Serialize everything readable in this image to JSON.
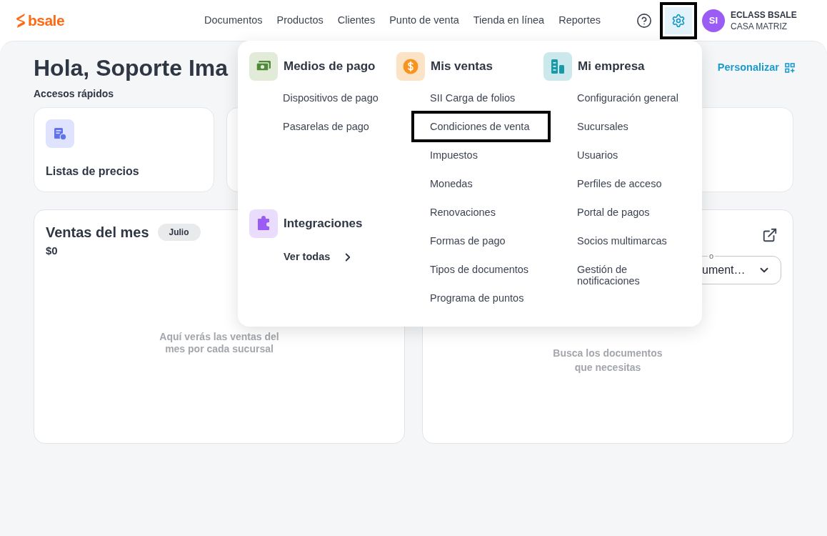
{
  "header": {
    "logo": "bsale",
    "nav": [
      {
        "label": "Documentos"
      },
      {
        "label": "Productos"
      },
      {
        "label": "Clientes"
      },
      {
        "label": "Punto de venta"
      },
      {
        "label": "Tienda en línea"
      },
      {
        "label": "Reportes"
      }
    ],
    "settings": {
      "highlighted": true
    },
    "user": {
      "initials": "SI",
      "name": "ECLASS BSALE",
      "branch": "CASA MATRIZ"
    }
  },
  "greeting": "Hola, Soporte Ima",
  "personalize": "Personalizar",
  "quick_access": {
    "title": "Accesos rápidos",
    "cards": [
      {
        "label": "Listas de precios"
      }
    ]
  },
  "sales_widget": {
    "title": "Ventas del mes",
    "badge": "Julio",
    "amount": "$0",
    "empty_text": "Aquí verás las ventas del mes por cada sucursal"
  },
  "documents_widget": {
    "select_label": "o",
    "select_value": "ument…",
    "empty_text": "Busca los documentos que necesitas"
  },
  "menu": {
    "sections": [
      {
        "title": "Medios de pago",
        "items": [
          {
            "label": "Dispositivos de pago",
            "highlighted": false
          },
          {
            "label": "Pasarelas de pago",
            "highlighted": false
          }
        ]
      },
      {
        "title": "Mis ventas",
        "items": [
          {
            "label": "SII Carga de folios",
            "highlighted": false
          },
          {
            "label": "Condiciones de venta",
            "highlighted": true
          },
          {
            "label": "Impuestos",
            "highlighted": false
          },
          {
            "label": "Monedas",
            "highlighted": false
          },
          {
            "label": "Renovaciones",
            "highlighted": false
          },
          {
            "label": "Formas de pago",
            "highlighted": false
          },
          {
            "label": "Tipos de documentos",
            "highlighted": false
          },
          {
            "label": "Programa de puntos",
            "highlighted": false
          }
        ]
      },
      {
        "title": "Mi empresa",
        "items": [
          {
            "label": "Configuración general",
            "highlighted": false
          },
          {
            "label": "Sucursales",
            "highlighted": false
          },
          {
            "label": "Usuarios",
            "highlighted": false
          },
          {
            "label": "Perfiles de acceso",
            "highlighted": false
          },
          {
            "label": "Portal de pagos",
            "highlighted": false
          },
          {
            "label": "Socios multimarcas",
            "highlighted": false
          },
          {
            "label": "Gestión de notificaciones",
            "highlighted": false
          }
        ]
      }
    ],
    "integrations": {
      "title": "Integraciones",
      "link": "Ver todas"
    }
  }
}
